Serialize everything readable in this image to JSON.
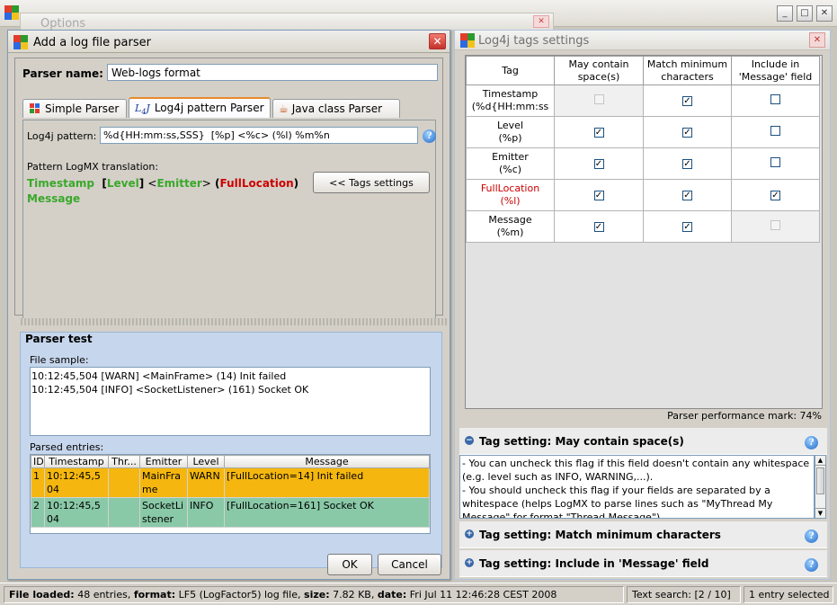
{
  "background_window": {
    "title": "Options"
  },
  "add_parser_dialog": {
    "title": "Add a log file parser",
    "parser_name_label": "Parser name:",
    "parser_name_value": "Web-logs format",
    "tabs": [
      {
        "label": "Simple Parser",
        "icon": "grid-icon"
      },
      {
        "label": "Log4j pattern Parser",
        "icon": "log4j-icon"
      },
      {
        "label": "Java class Parser",
        "icon": "java-cup-icon"
      }
    ],
    "active_tab": "Log4j pattern Parser",
    "log4j_pattern_label": "Log4j pattern:",
    "log4j_pattern_value": "%d{HH:mm:ss,SSS}  [%p] <%c> (%l) %m%n",
    "translation_label": "Pattern LogMX translation:",
    "translation": {
      "timestamp": "Timestamp",
      "bracket_open": "[",
      "level": "Level",
      "bracket_close": "]",
      "lt": "<",
      "emitter": "Emitter",
      "gt": ">",
      "paren_open": "(",
      "full_location": "FullLocation",
      "paren_close": ")",
      "message": "Message"
    },
    "tags_settings_button": "<< Tags settings",
    "parser_test": {
      "title": "Parser test",
      "file_sample_label": "File sample:",
      "file_sample_lines": [
        "10:12:45,504  [WARN] <MainFrame> (14) Init failed",
        "10:12:45,504  [INFO] <SocketListener> (161) Socket OK"
      ],
      "parsed_entries_label": "Parsed entries:",
      "columns": [
        "ID",
        "Timestamp",
        "Thr...",
        "Emitter",
        "Level",
        "Message"
      ],
      "rows": [
        {
          "id": "1",
          "timestamp": "10:12:45,504",
          "thread": "",
          "emitter": "MainFrame",
          "level": "WARN",
          "message": "[FullLocation=14] Init failed"
        },
        {
          "id": "2",
          "timestamp": "10:12:45,504",
          "thread": "",
          "emitter": "SocketListener",
          "level": "INFO",
          "message": "[FullLocation=161] Socket OK"
        }
      ]
    },
    "ok_button": "OK",
    "cancel_button": "Cancel"
  },
  "tags_window": {
    "title": "Log4j tags settings",
    "columns": [
      "Tag",
      "May contain space(s)",
      "Match minimum characters",
      "Include in 'Message' field"
    ],
    "rows": [
      {
        "tag": "Timestamp",
        "pattern": "(%d{HH:mm:ss",
        "may_contain_spaces": false,
        "may_contain_spaces_enabled": false,
        "match_min_chars": true,
        "include_in_message": false,
        "include_enabled": true,
        "highlight": false
      },
      {
        "tag": "Level",
        "pattern": "(%p)",
        "may_contain_spaces": true,
        "may_contain_spaces_enabled": true,
        "match_min_chars": true,
        "include_in_message": false,
        "include_enabled": true,
        "highlight": false
      },
      {
        "tag": "Emitter",
        "pattern": "(%c)",
        "may_contain_spaces": true,
        "may_contain_spaces_enabled": true,
        "match_min_chars": true,
        "include_in_message": false,
        "include_enabled": true,
        "highlight": false
      },
      {
        "tag": "FullLocation",
        "pattern": "(%l)",
        "may_contain_spaces": true,
        "may_contain_spaces_enabled": true,
        "match_min_chars": true,
        "include_in_message": true,
        "include_enabled": true,
        "highlight": true
      },
      {
        "tag": "Message",
        "pattern": "(%m)",
        "may_contain_spaces": true,
        "may_contain_spaces_enabled": true,
        "match_min_chars": true,
        "include_in_message": false,
        "include_enabled": false,
        "highlight": false
      }
    ],
    "performance_mark": "Parser performance mark: 74%",
    "sections": [
      {
        "title": "Tag setting: May contain space(s)",
        "expanded": true,
        "text": "- You can uncheck this flag if this field doesn't contain any whitespace (e.g. level such as INFO, WARNING,...).\n- You should uncheck this flag if your fields are separated by a whitespace (helps LogMX to parse lines such as \"MyThread My Message\" for format \"Thread Message\")"
      },
      {
        "title": "Tag setting: Match minimum characters",
        "expanded": false
      },
      {
        "title": "Tag setting: Include in 'Message' field",
        "expanded": false
      }
    ]
  },
  "status_bar": {
    "file_loaded_label": "File loaded:",
    "file_loaded_value": "48 entries,",
    "format_label": "format:",
    "format_value": "LF5 (LogFactor5) log file,",
    "size_label": "size:",
    "size_value": "7.82 KB,",
    "date_label": "date:",
    "date_value": "Fri Jul 11 12:46:28 CEST 2008",
    "text_search": "Text search: [2 / 10]",
    "selection": "1 entry selected"
  },
  "colors": {
    "green": "#3aa82a",
    "red": "#cc0000",
    "warn_row": "#f5b70f",
    "info_row": "#89c9a7",
    "tab_accent": "#e68b2c"
  }
}
